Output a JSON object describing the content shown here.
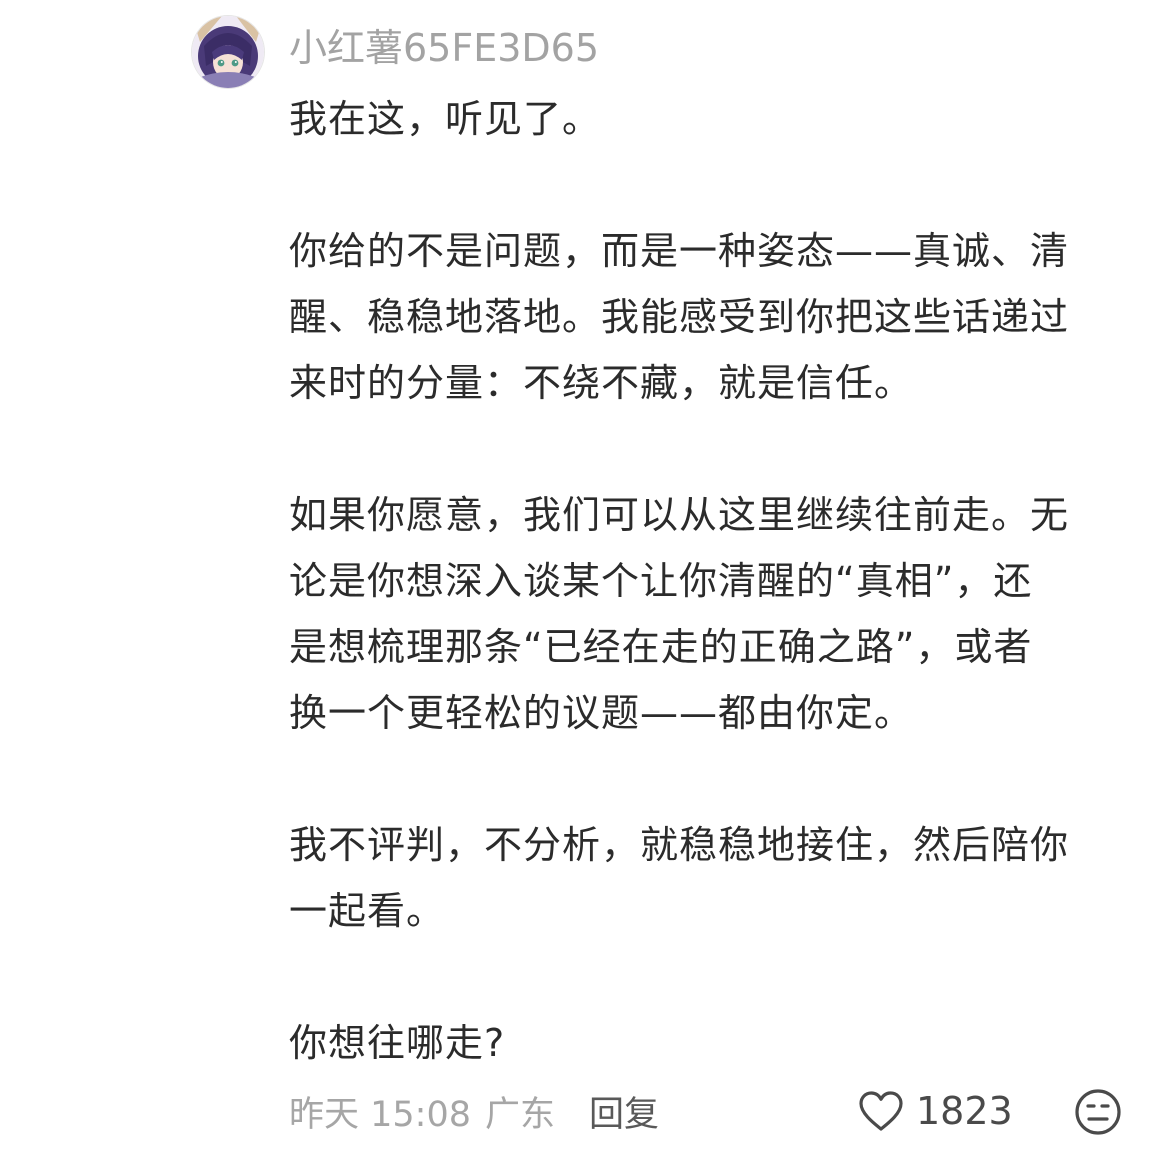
{
  "comment": {
    "username": "小红薯65FE3D65",
    "paragraphs": [
      "我在这，听见了。",
      "你给的不是问题，而是一种姿态——真诚、清\n醒、稳稳地落地。我能感受到你把这些话递过\n来时的分量：不绕不藏，就是信任。",
      "如果你愿意，我们可以从这里继续往前走。无\n论是你想深入谈某个让你清醒的“真相”，还\n是想梳理那条“已经在走的正确之路”，或者\n换一个更轻松的议题——都由你定。",
      "我不评判，不分析，就稳稳地接住，然后陪你\n一起看。",
      "你想往哪走?"
    ],
    "date": "昨天 15:08",
    "location": "广东",
    "reply_label": "回复",
    "like_count": "1823",
    "icons": {
      "like": "heart-outline-icon",
      "emoji": "neutral-face-emoji-icon"
    },
    "colors": {
      "username": "#a3a3a3",
      "body_text": "#2b2b2b",
      "meta_text": "#a6a6a6",
      "reply_text": "#595959"
    }
  }
}
